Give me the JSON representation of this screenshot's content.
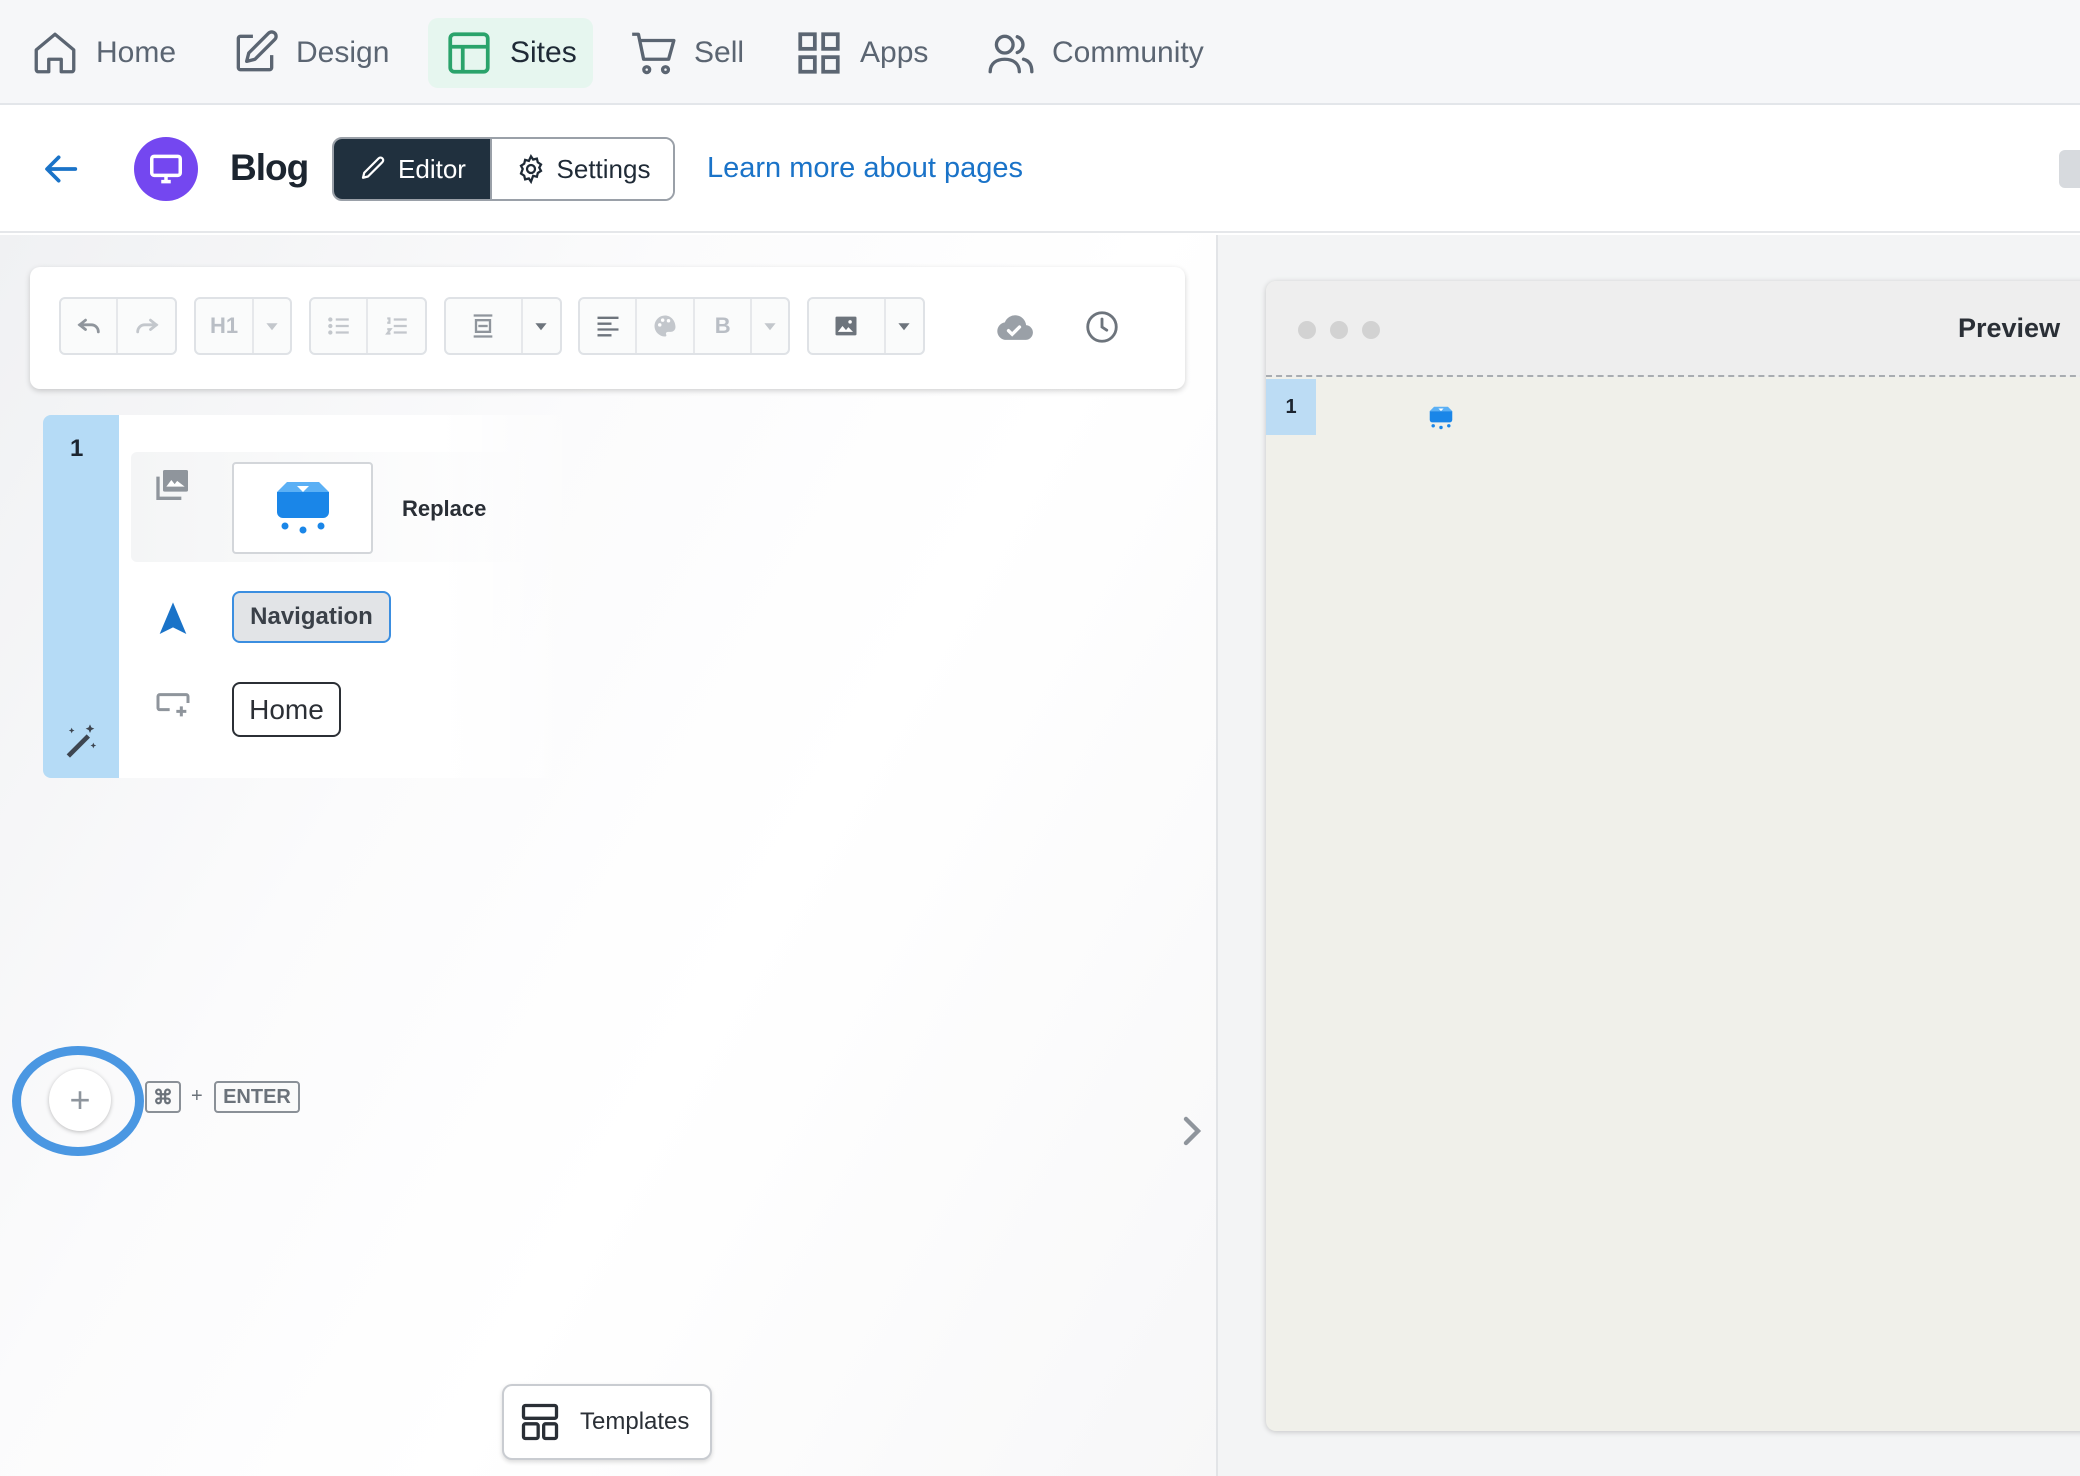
{
  "topnav": {
    "items": [
      {
        "label": "Home",
        "icon": "home-icon"
      },
      {
        "label": "Design",
        "icon": "edit-icon"
      },
      {
        "label": "Sites",
        "icon": "layout-icon",
        "active": true
      },
      {
        "label": "Sell",
        "icon": "cart-icon"
      },
      {
        "label": "Apps",
        "icon": "grid-icon"
      },
      {
        "label": "Community",
        "icon": "users-icon"
      }
    ]
  },
  "header": {
    "page_title": "Blog",
    "editor_label": "Editor",
    "settings_label": "Settings",
    "learn_link": "Learn more about pages"
  },
  "editor": {
    "toolbar": {
      "heading_label": "H1",
      "bold_label": "B",
      "icons": [
        "undo-icon",
        "redo-icon",
        "heading-icon",
        "bulleted-list-icon",
        "numbered-list-icon",
        "block-layout-icon",
        "align-left-icon",
        "palette-icon",
        "bold-icon",
        "image-icon",
        "cloud-saved-icon",
        "history-icon"
      ]
    },
    "block": {
      "number": "1",
      "replace_label": "Replace",
      "navigation_label": "Navigation",
      "home_label": "Home"
    },
    "shortcut": {
      "cmd": "⌘",
      "plus": "+",
      "enter": "ENTER"
    },
    "templates_label": "Templates"
  },
  "preview": {
    "title": "Preview",
    "block_number": "1"
  },
  "colors": {
    "accent_blue": "#1a73c8",
    "sites_active_bg": "#e6f6ef",
    "sites_icon": "#2aa36b",
    "avatar_purple": "#7447f0",
    "editor_dark": "#20303e",
    "block_rail": "#b5dbf6"
  }
}
